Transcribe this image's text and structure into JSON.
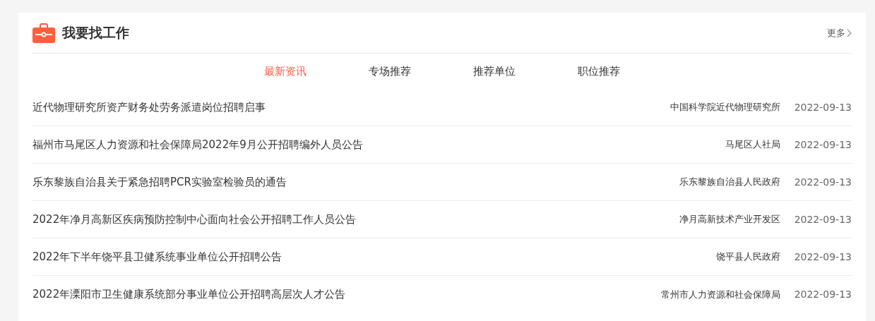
{
  "section": {
    "title": "我要找工作",
    "more": "更多"
  },
  "tabs": [
    {
      "label": "最新资讯",
      "selected": true
    },
    {
      "label": "专场推荐",
      "selected": false
    },
    {
      "label": "推荐单位",
      "selected": false
    },
    {
      "label": "职位推荐",
      "selected": false
    }
  ],
  "rows": [
    {
      "title": "近代物理研究所资产财务处劳务派遣岗位招聘启事",
      "org": "中国科学院近代物理研究所",
      "date": "2022-09-13"
    },
    {
      "title": "福州市马尾区人力资源和社会保障局2022年9月公开招聘编外人员公告",
      "org": "马尾区人社局",
      "date": "2022-09-13"
    },
    {
      "title": "乐东黎族自治县关于紧急招聘PCR实验室检验员的通告",
      "org": "乐东黎族自治县人民政府",
      "date": "2022-09-13"
    },
    {
      "title": "2022年净月高新区疾病预防控制中心面向社会公开招聘工作人员公告",
      "org": "净月高新技术产业开发区",
      "date": "2022-09-13"
    },
    {
      "title": "2022年下半年饶平县卫健系统事业单位公开招聘公告",
      "org": "饶平县人民政府",
      "date": "2022-09-13"
    },
    {
      "title": "2022年溧阳市卫生健康系统部分事业单位公开招聘高层次人才公告",
      "org": "常州市人力资源和社会保障局",
      "date": "2022-09-13"
    }
  ]
}
